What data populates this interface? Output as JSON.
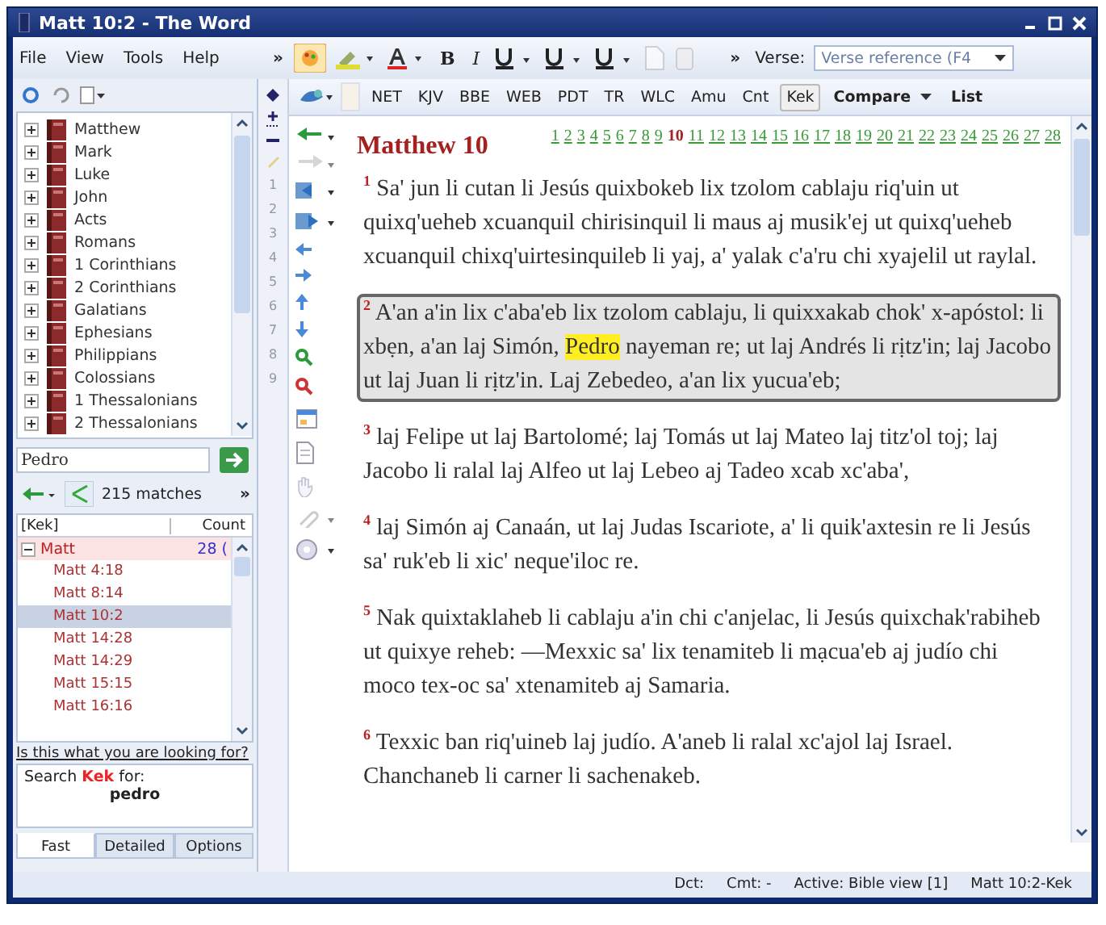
{
  "window": {
    "title": "Matt 10:2 - The Word"
  },
  "menu": [
    "File",
    "View",
    "Tools",
    "Help"
  ],
  "toolbar_overflow": [
    "»",
    "»"
  ],
  "format_buttons": [
    "B",
    "I"
  ],
  "verse_box": {
    "label": "Verse:",
    "value": "Verse reference (F4"
  },
  "versions": [
    {
      "label": "NET",
      "selected": false
    },
    {
      "label": "KJV",
      "selected": false
    },
    {
      "label": "BBE",
      "selected": false
    },
    {
      "label": "WEB",
      "selected": false
    },
    {
      "label": "PDT",
      "selected": false
    },
    {
      "label": "TR",
      "selected": false
    },
    {
      "label": "WLC",
      "selected": false
    },
    {
      "label": "Amu",
      "selected": false
    },
    {
      "label": "Cnt",
      "selected": false
    },
    {
      "label": "Kek",
      "selected": true
    }
  ],
  "compare": "Compare",
  "list": "List",
  "books": [
    "Matthew",
    "Mark",
    "Luke",
    "John",
    "Acts",
    "Romans",
    "1 Corinthians",
    "2 Corinthians",
    "Galatians",
    "Ephesians",
    "Philippians",
    "Colossians",
    "1 Thessalonians",
    "2 Thessalonians"
  ],
  "strip_numbers": [
    "1",
    "2",
    "3",
    "4",
    "5",
    "6",
    "7",
    "8",
    "9"
  ],
  "search": {
    "value": "Pedro",
    "matches": "215 matches",
    "overflow": "»",
    "columns": [
      "[Kek]",
      "Count"
    ],
    "groups": [
      {
        "label": "Matt",
        "count": "28 (",
        "expanded": true,
        "children": [
          {
            "label": "Matt 4:18",
            "selected": false
          },
          {
            "label": "Matt 8:14",
            "selected": false
          },
          {
            "label": "Matt 10:2",
            "selected": true
          },
          {
            "label": "Matt 14:28",
            "selected": false
          },
          {
            "label": "Matt 14:29",
            "selected": false
          },
          {
            "label": "Matt 15:15",
            "selected": false
          },
          {
            "label": "Matt 16:16",
            "selected": false
          }
        ]
      }
    ],
    "hint": "Is this what you are looking for?",
    "suggestion": {
      "prefix": "Search",
      "module": "Kek",
      "suffix": "for:",
      "term": "pedro"
    },
    "tabs": [
      {
        "label": "Fast",
        "selected": true
      },
      {
        "label": "Detailed",
        "selected": false
      },
      {
        "label": "Options",
        "selected": false
      }
    ]
  },
  "chapter": {
    "title": "Matthew 10",
    "links": [
      {
        "label": "1",
        "current": false
      },
      {
        "label": "2",
        "current": false
      },
      {
        "label": "3",
        "current": false
      },
      {
        "label": "4",
        "current": false
      },
      {
        "label": "5",
        "current": false
      },
      {
        "label": "6",
        "current": false
      },
      {
        "label": "7",
        "current": false
      },
      {
        "label": "8",
        "current": false
      },
      {
        "label": "9",
        "current": false
      },
      {
        "label": "10",
        "current": true
      },
      {
        "label": "11",
        "current": false
      },
      {
        "label": "12",
        "current": false
      },
      {
        "label": "13",
        "current": false
      },
      {
        "label": "14",
        "current": false
      },
      {
        "label": "15",
        "current": false
      },
      {
        "label": "16",
        "current": false
      },
      {
        "label": "17",
        "current": false
      },
      {
        "label": "18",
        "current": false
      },
      {
        "label": "19",
        "current": false
      },
      {
        "label": "20",
        "current": false
      },
      {
        "label": "21",
        "current": false
      },
      {
        "label": "22",
        "current": false
      },
      {
        "label": "23",
        "current": false
      },
      {
        "label": "24",
        "current": false
      },
      {
        "label": "25",
        "current": false
      },
      {
        "label": "26",
        "current": false
      },
      {
        "label": "27",
        "current": false
      },
      {
        "label": "28",
        "current": false
      }
    ]
  },
  "verses": [
    {
      "number": "1",
      "selected": false,
      "segments": [
        {
          "text": "Sa' jun li cutan li Jesús quixbokeb lix tzolom cablaju riq'uin ut quixq'ueheb xcuanquil chirisinquil li maus aj musik'ej ut quixq'ueheb xcuanquil chixq'uirtesinquileb li yaj, a' yalak c'a'ru chi xyajelil ut raylal.",
          "highlighted": false
        }
      ]
    },
    {
      "number": "2",
      "selected": true,
      "segments": [
        {
          "text": "A'an a'in lix c'aba'eb lix tzolom cablaju, li quixxakab chok' x-apóstol: li xbẹn, a'an laj Simón, ",
          "highlighted": false
        },
        {
          "text": "Pedro",
          "highlighted": true
        },
        {
          "text": " nayeman re; ut laj Andrés li rịtz'in; laj Jacobo ut laj Juan li rịtz'in. Laj Zebedeo, a'an lix yucua'eb;",
          "highlighted": false
        }
      ]
    },
    {
      "number": "3",
      "selected": false,
      "segments": [
        {
          "text": "laj Felipe ut laj Bartolomé; laj Tomás ut laj Mateo laj titz'ol toj; laj Jacobo li ralal laj Alfeo ut laj Lebeo aj Tadeo xcab xc'aba',",
          "highlighted": false
        }
      ]
    },
    {
      "number": "4",
      "selected": false,
      "segments": [
        {
          "text": "laj Simón aj Canaán, ut laj Judas Iscariote, a' li quik'axtesin re li Jesús sa' ruk'eb li xic' neque'iloc re.",
          "highlighted": false
        }
      ]
    },
    {
      "number": "5",
      "selected": false,
      "segments": [
        {
          "text": "Nak quixtaklaheb li cablaju a'in chi c'anjelac, li Jesús quixchak'rabiheb ut quixye reheb: —Mexxic sa' lix tenamiteb li mạcua'eb aj judío chi moco tex-oc sa' xtenamiteb aj Samaria.",
          "highlighted": false
        }
      ]
    },
    {
      "number": "6",
      "selected": false,
      "segments": [
        {
          "text": "Texxic ban riq'uineb laj judío. A'aneb li ralal xc'ajol laj Israel. Chanchaneb li carner li sachenakeb.",
          "highlighted": false
        }
      ]
    }
  ],
  "status_bar": [
    "Dct:",
    "Cmt: -",
    "Active: Bible view [1]",
    "Matt 10:2-Kek"
  ]
}
